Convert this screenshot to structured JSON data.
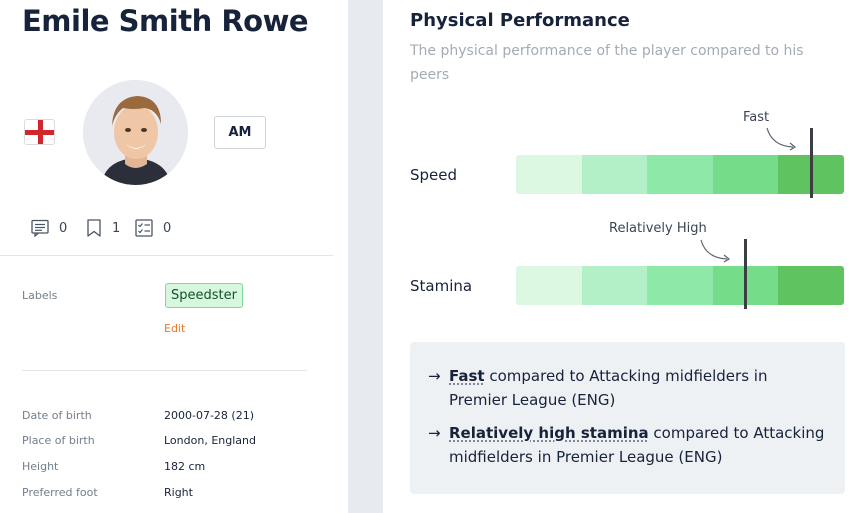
{
  "player": {
    "name": "Emile Smith Rowe",
    "position": "AM",
    "nationality_flag": "england-flag"
  },
  "counters": [
    {
      "icon": "comment-icon",
      "value": "0"
    },
    {
      "icon": "bookmark-icon",
      "value": "1"
    },
    {
      "icon": "checklist-icon",
      "value": "0"
    }
  ],
  "labels": {
    "title": "Labels",
    "tag": "Speedster",
    "edit": "Edit"
  },
  "details": [
    {
      "label": "Date of birth",
      "value": "2000-07-28 (21)"
    },
    {
      "label": "Place of birth",
      "value": "London, England"
    },
    {
      "label": "Height",
      "value": "182 cm"
    },
    {
      "label": "Preferred foot",
      "value": "Right"
    }
  ],
  "physical": {
    "title": "Physical Performance",
    "subtitle": "The physical performance of the player compared to his peers",
    "segment_colors": [
      "#dcf8e3",
      "#b4f0c7",
      "#8ee8a8",
      "#75dd89",
      "#5fc45f"
    ],
    "metrics": [
      {
        "name": "Speed",
        "rating": "Fast",
        "level": 0.902
      },
      {
        "name": "Stamina",
        "rating": "Relatively High",
        "level": 0.701
      }
    ]
  },
  "summary": {
    "arrow": "→",
    "items": [
      {
        "strong": "Fast",
        "rest": " compared to Attacking midfielders in Premier League (ENG)"
      },
      {
        "strong": "Relatively high stamina",
        "rest": " compared to Attacking midfielders in Premier League (ENG)"
      }
    ]
  }
}
